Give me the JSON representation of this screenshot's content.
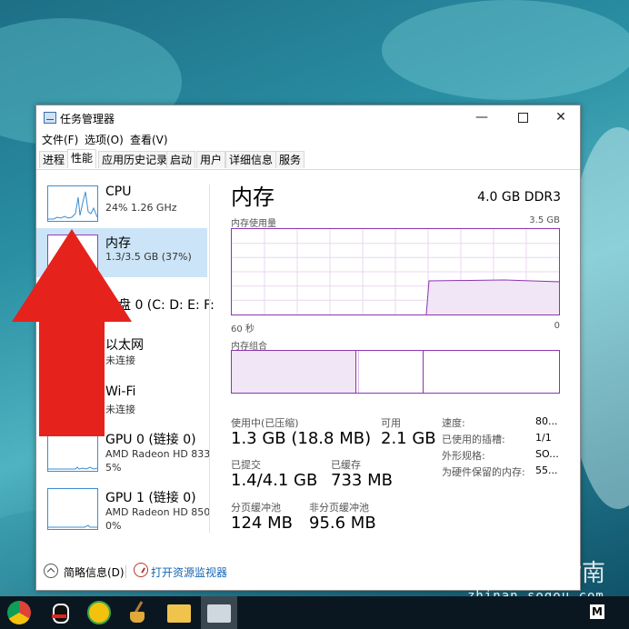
{
  "window": {
    "title": "任务管理器",
    "minimize_glyph": "—",
    "close_glyph": "✕"
  },
  "menu": [
    "文件(F)",
    "选项(O)",
    "查看(V)"
  ],
  "tabs": [
    {
      "label": "进程",
      "active": false
    },
    {
      "label": "性能",
      "active": true
    },
    {
      "label": "应用历史记录",
      "active": false
    },
    {
      "label": "启动",
      "active": false
    },
    {
      "label": "用户",
      "active": false
    },
    {
      "label": "详细信息",
      "active": false
    },
    {
      "label": "服务",
      "active": false
    }
  ],
  "sidebar": {
    "items": [
      {
        "name": "CPU",
        "detail": "24% 1.26 GHz",
        "detail2": ""
      },
      {
        "name": "内存",
        "detail": "1.3/3.5 GB (37%)",
        "detail2": ""
      },
      {
        "name": "磁盘 0 (C: D: E: F:",
        "detail": "",
        "detail2": ""
      },
      {
        "name": "以太网",
        "detail": "未连接",
        "detail2": ""
      },
      {
        "name": "Wi-Fi",
        "detail": "未连接",
        "detail2": ""
      },
      {
        "name": "GPU 0 (链接 0)",
        "detail": "AMD Radeon HD 833",
        "detail2": "5%"
      },
      {
        "name": "GPU 1 (链接 0)",
        "detail": "AMD Radeon HD 850",
        "detail2": "0%"
      }
    ]
  },
  "main": {
    "title": "内存",
    "spec": "4.0 GB DDR3",
    "usage_label": "内存使用量",
    "usage_max": "3.5 GB",
    "time_left": "60 秒",
    "time_right": "0",
    "composition_label": "内存组合",
    "stats": {
      "in_use_label": "使用中(已压缩)",
      "in_use_value": "1.3 GB (18.8 MB)",
      "available_label": "可用",
      "available_value": "2.1 GB",
      "committed_label": "已提交",
      "committed_value": "1.4/4.1 GB",
      "cached_label": "已缓存",
      "cached_value": "733 MB",
      "paged_label": "分页缓冲池",
      "paged_value": "124 MB",
      "nonpaged_label": "非分页缓冲池",
      "nonpaged_value": "95.6 MB"
    },
    "details": [
      {
        "label": "速度:",
        "value": "80..."
      },
      {
        "label": "已使用的插槽:",
        "value": "1/1"
      },
      {
        "label": "外形规格:",
        "value": "SO..."
      },
      {
        "label": "为硬件保留的内存:",
        "value": "55..."
      }
    ],
    "graph_levels": {
      "usage_fraction_recent": 0.37
    },
    "colors": {
      "memory": "#8b35b0",
      "cpu": "#3b8ed0"
    }
  },
  "footer": {
    "fewer_details": "简略信息(D)",
    "resource_monitor": "打开资源监视器"
  },
  "watermark": {
    "text": "搜狗指南",
    "url": "zhinan.sogou.com"
  },
  "taskbar": {
    "icons": [
      "chrome-icon",
      "qq-icon",
      "browser-icon",
      "broom-icon",
      "file-explorer-icon",
      "task-manager-icon"
    ],
    "badge": "M"
  }
}
